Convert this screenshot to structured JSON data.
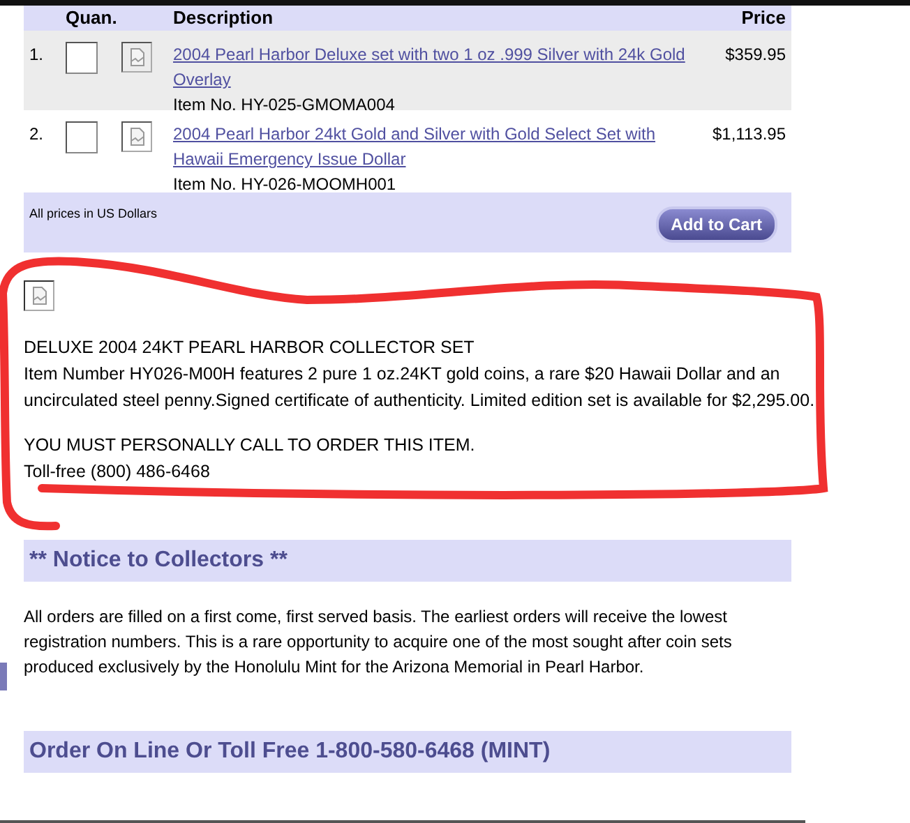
{
  "table": {
    "columns": [
      "Quan.",
      "Description",
      "Price"
    ],
    "rows": [
      {
        "number": "1.",
        "title": "2004 Pearl Harbor Deluxe set with two 1 oz .999 Silver with 24k Gold Overlay",
        "item_no": "Item No. HY-025-GMOMA004",
        "price": "$359.95"
      },
      {
        "number": "2.",
        "title": "2004 Pearl Harbor 24kt Gold and Silver with Gold Select Set with Hawaii Emergency Issue Dollar",
        "item_no": "Item No. HY-026-MOOMH001",
        "price": "$1,113.95"
      }
    ],
    "footer_note": "All prices in US Dollars",
    "button": "Add to Cart"
  },
  "feature": {
    "heading": "DELUXE 2004 24KT PEARL HARBOR COLLECTOR SET",
    "description": "Item Number HY026-M00H features 2 pure 1 oz.24KT gold coins, a rare $20 Hawaii Dollar and an uncirculated steel penny.Signed certificate of authenticity. Limited edition set is available for $2,295.00.",
    "call_notice": "YOU MUST PERSONALLY CALL TO ORDER THIS ITEM.",
    "phone": "Toll-free (800) 486-6468"
  },
  "notice": {
    "heading": "** Notice to Collectors **",
    "text": "All orders are filled on a first come, first served basis. The earliest orders will receive the lowest registration numbers. This is a rare opportunity to acquire one of the most sought after coin sets produced exclusively by the Honolulu Mint for the Arizona Memorial in Pearl Harbor."
  },
  "order_banner": "Order On Line Or Toll Free 1-800-580-6468 (MINT)"
}
